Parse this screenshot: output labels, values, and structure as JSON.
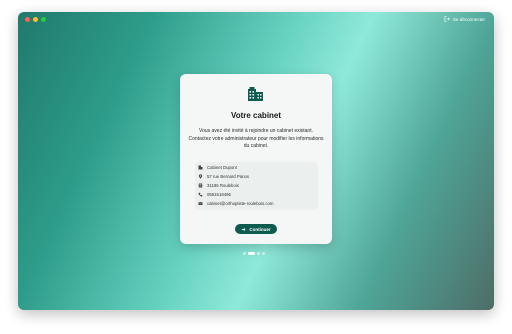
{
  "window": {
    "traffic_colors": [
      "#ff5f57",
      "#febc2e",
      "#28c840"
    ]
  },
  "header": {
    "logout_label": "Se déconnecter"
  },
  "card": {
    "icon": "building-icon",
    "title": "Votre cabinet",
    "description": "Vous avez été invité à rejoindre un cabinet existant. Contactez votre administrateur pour modifier les informations du cabinet.",
    "info": [
      {
        "icon": "building-icon",
        "text": "Cabinet Dupont"
      },
      {
        "icon": "location-pin-icon",
        "text": "57 rue Bernard Panos"
      },
      {
        "icon": "postal-code-icon",
        "text": "31185 Roulebois"
      },
      {
        "icon": "phone-icon",
        "text": "0551618496"
      },
      {
        "icon": "email-icon",
        "text": "cabinet@orthoptiste-roulebois.com"
      }
    ],
    "continue_label": "Continuer"
  },
  "pagination": {
    "count": 4,
    "active_index": 1
  },
  "colors": {
    "accent": "#0e5b4f",
    "card_background": "#f4f7f6"
  }
}
